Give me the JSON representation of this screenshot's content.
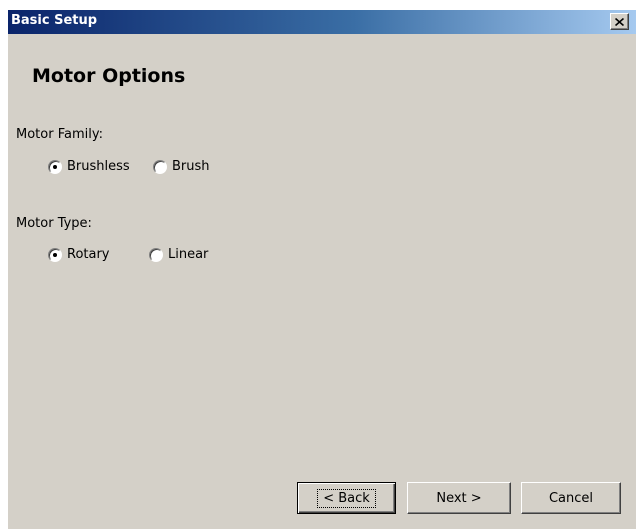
{
  "window": {
    "title": "Basic Setup",
    "close_glyph": "✕"
  },
  "page": {
    "heading": "Motor Options"
  },
  "motor_family": {
    "label": "Motor Family:",
    "options": [
      {
        "label": "Brushless",
        "selected": true
      },
      {
        "label": "Brush",
        "selected": false
      }
    ]
  },
  "motor_type": {
    "label": "Motor Type:",
    "options": [
      {
        "label": "Rotary",
        "selected": true
      },
      {
        "label": "Linear",
        "selected": false
      }
    ]
  },
  "buttons": {
    "back": "< Back",
    "next": "Next >",
    "cancel": "Cancel"
  },
  "colors": {
    "dialog_bg": "#d4d0c8",
    "title_start": "#0a246a",
    "title_end": "#a6caf0"
  }
}
